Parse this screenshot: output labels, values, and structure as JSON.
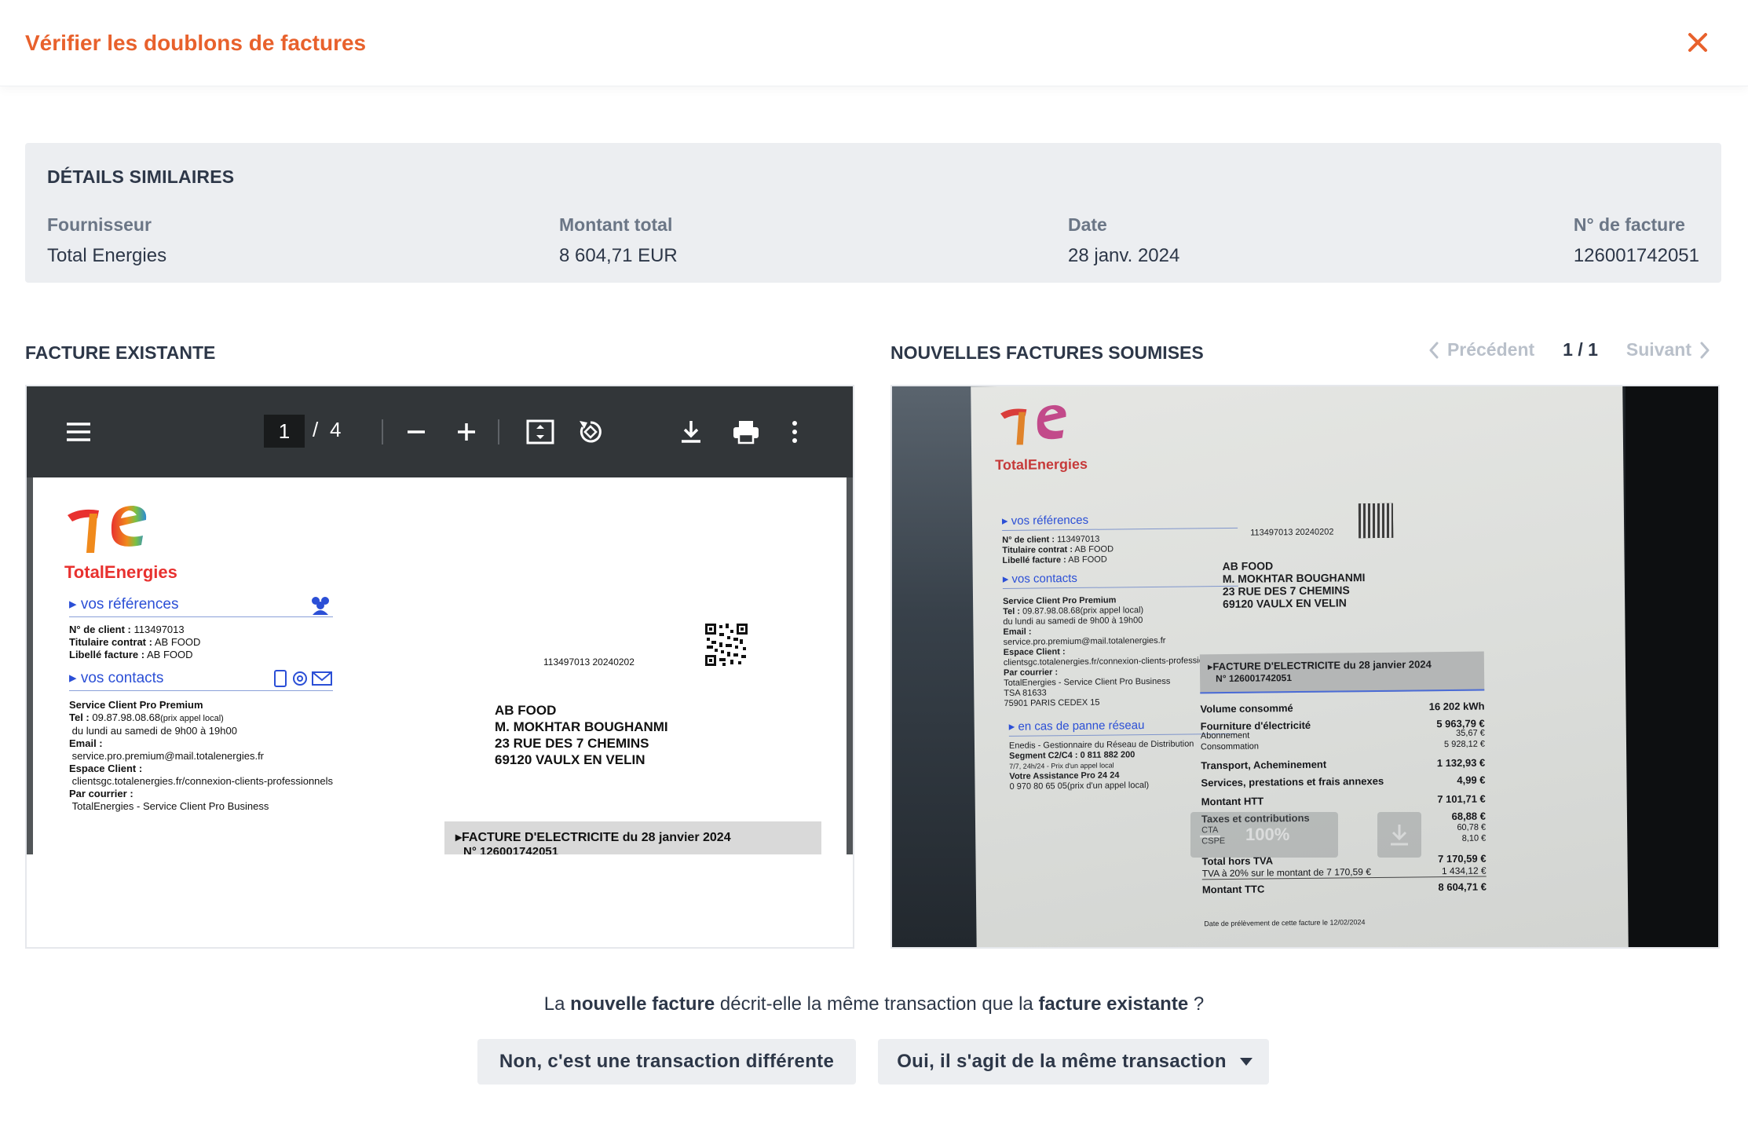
{
  "header": {
    "title": "Vérifier les doublons de factures"
  },
  "details": {
    "heading": "DÉTAILS SIMILAIRES",
    "fields": [
      {
        "label": "Fournisseur",
        "value": "Total Energies"
      },
      {
        "label": "Montant total",
        "value": "8 604,71 EUR"
      },
      {
        "label": "Date",
        "value": "28 janv. 2024"
      },
      {
        "label": "N° de facture",
        "value": "126001742051"
      }
    ]
  },
  "existing": {
    "title": "FACTURE EXISTANTE",
    "viewer": {
      "page": "1",
      "separator": "/",
      "total": "4"
    }
  },
  "submitted": {
    "title": "NOUVELLES FACTURES SOUMISES",
    "pager": {
      "prev": "Précédent",
      "count": "1 / 1",
      "next": "Suivant"
    }
  },
  "invoice": {
    "brand": "TotalEnergies",
    "refs_title": "vos références",
    "client_no_label": "N° de client :",
    "client_no": "113497013",
    "holder_label": "Titulaire contrat :",
    "holder": "AB FOOD",
    "invoice_label_label": "Libellé facture :",
    "invoice_label": "AB FOOD",
    "contacts_title": "vos contacts",
    "service": "Service Client Pro Premium",
    "tel_label": "Tel :",
    "tel": "09.87.98.08.68",
    "tel_note": "(prix appel local)",
    "hours": "du lundi au samedi de 9h00 à 19h00",
    "email_label": "Email :",
    "email": "service.pro.premium@mail.totalenergies.fr",
    "space_label": "Espace Client :",
    "space": "clientsgc.totalenergies.fr/connexion-clients-professionnels",
    "mail_label": "Par courrier :",
    "mail": "TotalEnergies - Service Client Pro Business",
    "barcode_text": "113497013  20240202",
    "addr": [
      "AB FOOD",
      "M. MOKHTAR BOUGHANMI",
      "23 RUE DES 7 CHEMINS",
      "69120 VAULX EN VELIN"
    ],
    "bill_title": "▸FACTURE D'ELECTRICITE du 28 janvier 2024",
    "bill_no": "N° 126001742051"
  },
  "photo": {
    "mail_extra": [
      "TotalEnergies - Service Client Pro Business",
      "TSA 81633",
      "75901 PARIS CEDEX 15"
    ],
    "panne_title": "en cas de panne réseau",
    "panne": [
      "Enedis - Gestionnaire du Réseau de Distribution",
      "Segment C2/C4 :  0 811 882 200",
      "7/7, 24h/24 - Prix d'un appel local",
      "Votre Assistance Pro 24 24",
      "0 970 80 65 05(prix d'un appel local)"
    ],
    "rows": [
      {
        "label": "Volume consommé",
        "value": "16 202 kWh"
      },
      {
        "label": "Fourniture d'électricité",
        "value": "5 963,79 €"
      },
      {
        "label": "Abonnement",
        "value": "35,67 €"
      },
      {
        "label": "Consommation",
        "value": "5 928,12 €"
      },
      {
        "label": "Transport, Acheminement",
        "value": "1 132,93 €"
      },
      {
        "label": "Services, prestations et frais annexes",
        "value": "4,99 €"
      },
      {
        "label": "Montant HTT",
        "value": "7 101,71 €"
      },
      {
        "label": "Taxes et contributions",
        "value": "68,88 €"
      },
      {
        "label": "CTA",
        "value": "60,78 €"
      },
      {
        "label": "CSPE",
        "value": "8,10 €"
      },
      {
        "label": "Total hors TVA",
        "value": "7 170,59 €"
      },
      {
        "label": "TVA à 20% sur le montant de 7 170,59 €",
        "value": "1 434,12 €"
      },
      {
        "label": "Montant TTC",
        "value": "8 604,71 €"
      }
    ],
    "footnote": "Date de prélèvement de cette facture le 12/02/2024",
    "zoom": "100%"
  },
  "question": {
    "p1": "La ",
    "b1": "nouvelle facture",
    "p2": " décrit-elle la même transaction que la ",
    "b2": "facture existante",
    "p3": " ?"
  },
  "actions": {
    "no": "Non, c'est une transaction différente",
    "yes": "Oui, il s'agit de la même transaction"
  },
  "colors": {
    "accent": "#e8612c",
    "text": "#2d3748",
    "muted": "#6b7686",
    "panel_bg": "#eceef1"
  }
}
